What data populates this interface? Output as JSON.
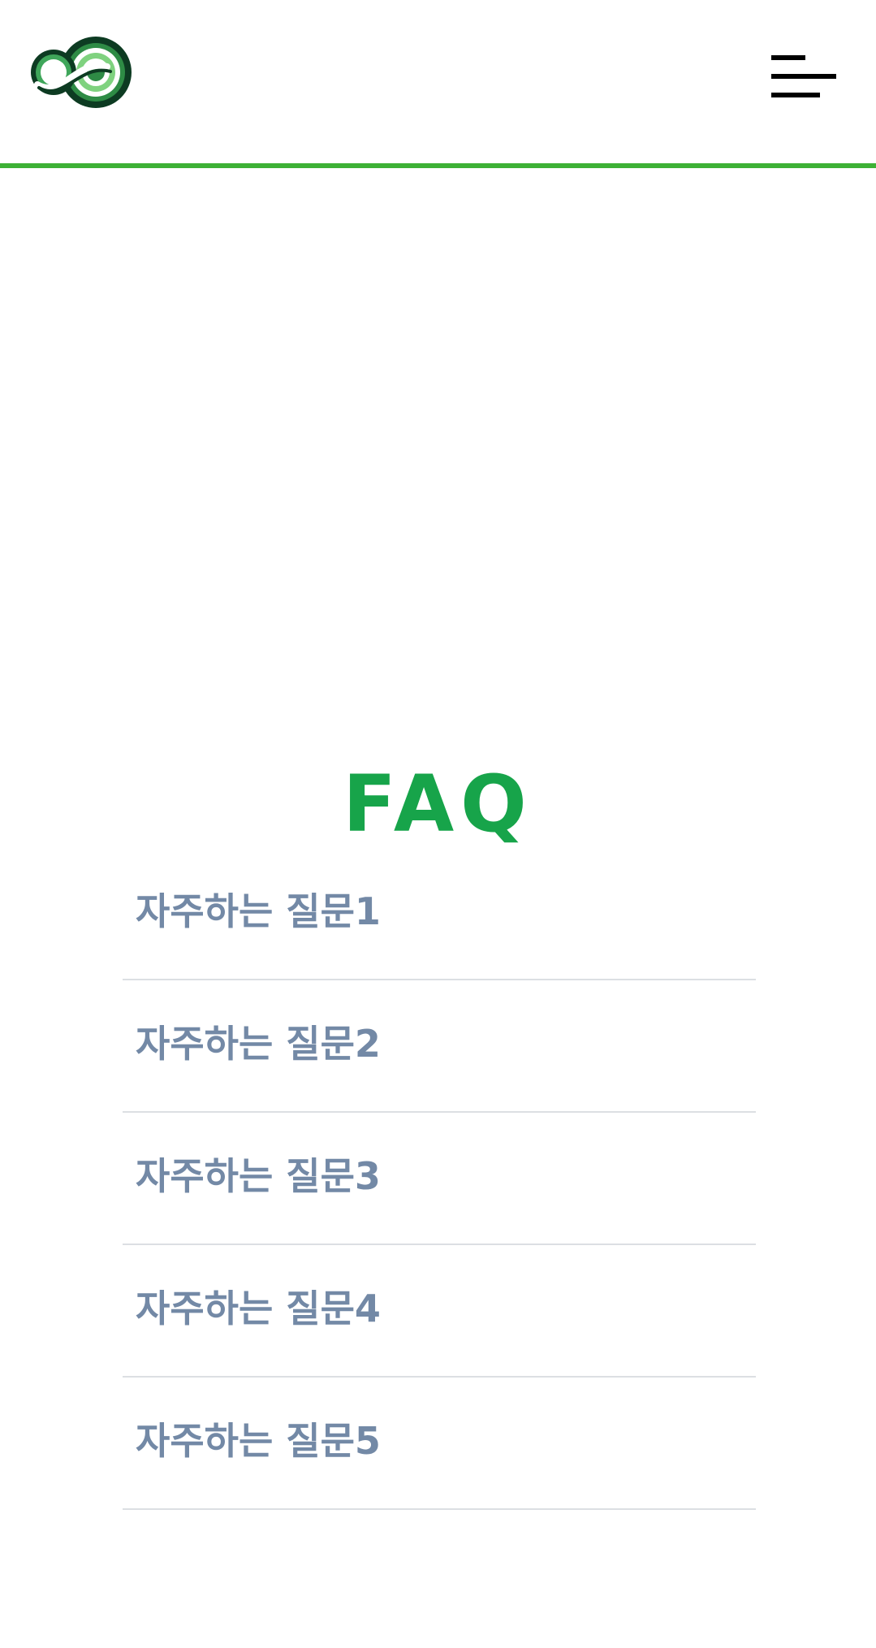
{
  "header": {
    "logo_icon": "infinity-logo-icon",
    "menu_icon": "hamburger-menu-icon",
    "accent_color": "#3db135"
  },
  "faq": {
    "title": "FAQ",
    "title_color": "#17a44a",
    "question_color": "#7389a6",
    "items": [
      {
        "question": "자주하는 질문1"
      },
      {
        "question": "자주하는 질문2"
      },
      {
        "question": "자주하는 질문3"
      },
      {
        "question": "자주하는 질문4"
      },
      {
        "question": "자주하는 질문5"
      }
    ]
  }
}
